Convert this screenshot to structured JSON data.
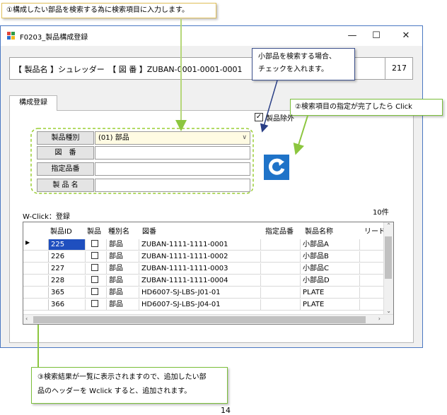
{
  "callouts": {
    "c1": "①構成したい部品を検索する為に検索項目に入力します。",
    "c2_line1": "小部品を検索する場合、",
    "c2_line2": "チェックを入れます。",
    "c3": "②検索項目の指定が完了したら Click",
    "c4_line1": "③検索結果が一覧に表示されますので、追加したい部",
    "c4_line2": "品のヘッダーを Wclick すると、追加されます。"
  },
  "window": {
    "title": "F0203_製品構成登録",
    "minimize": "—",
    "maximize": "☐",
    "close": "✕"
  },
  "header": {
    "product_label": "【 製品名 】シュレッダー　【 図 番 】ZUBAN-0001-0001-0001",
    "number": "217"
  },
  "tab": {
    "label": "構成登録"
  },
  "form": {
    "type_label": "製品種別",
    "type_value": "(01) 部品",
    "drawing_label": "図　番",
    "drawing_value": "",
    "spec_label": "指定品番",
    "spec_value": "",
    "name_label": "製 品 名",
    "name_value": "",
    "exclude_label": "製品除外",
    "exclude_checked": "✓"
  },
  "results": {
    "hint": "W-Click：登録",
    "count": "10件",
    "columns": [
      "製品ID",
      "製品",
      "種別名",
      "図番",
      "指定品番",
      "製品名称",
      "リード"
    ],
    "rows": [
      [
        "225",
        "",
        "部品",
        "ZUBAN-1111-1111-0001",
        "",
        "小部品A",
        ""
      ],
      [
        "226",
        "",
        "部品",
        "ZUBAN-1111-1111-0002",
        "",
        "小部品B",
        ""
      ],
      [
        "227",
        "",
        "部品",
        "ZUBAN-1111-1111-0003",
        "",
        "小部品C",
        ""
      ],
      [
        "228",
        "",
        "部品",
        "ZUBAN-1111-1111-0004",
        "",
        "小部品D",
        ""
      ],
      [
        "365",
        "",
        "部品",
        "HD6007-SJ-LBS-J01-01",
        "",
        "PLATE",
        ""
      ],
      [
        "366",
        "",
        "部品",
        "HD6007-SJ-LBS-J04-01",
        "",
        "PLATE",
        ""
      ]
    ]
  },
  "page_number": "14",
  "colors": {
    "accent_blue": "#1f73c8",
    "guide_green": "#9acd32",
    "selected_id_blue": "#1f4fbf"
  }
}
